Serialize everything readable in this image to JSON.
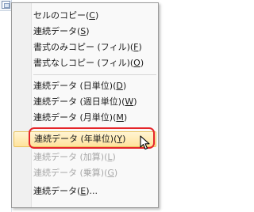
{
  "context_menu": {
    "items": [
      {
        "text": "セルのコピー(",
        "key": "C",
        "suffix": ")",
        "disabled": false
      },
      {
        "text": "連続データ(",
        "key": "S",
        "suffix": ")",
        "disabled": false
      },
      {
        "text": "書式のみコピー (フィル)(",
        "key": "F",
        "suffix": ")",
        "disabled": false
      },
      {
        "text": "書式なしコピー (フィル)(",
        "key": "O",
        "suffix": ")",
        "disabled": false
      },
      {
        "text": "連続データ (日単位)(",
        "key": "D",
        "suffix": ")",
        "disabled": false
      },
      {
        "text": "連続データ (週日単位)(",
        "key": "W",
        "suffix": ")",
        "disabled": false
      },
      {
        "text": "連続データ (月単位)(",
        "key": "M",
        "suffix": ")",
        "disabled": false
      },
      {
        "text": "連続データ (年単位)(",
        "key": "Y",
        "suffix": ")",
        "disabled": false,
        "highlighted": true
      },
      {
        "text": "連続データ (加算)(",
        "key": "L",
        "suffix": ")",
        "disabled": true
      },
      {
        "text": "連続データ (乗算)(",
        "key": "G",
        "suffix": ")",
        "disabled": true
      },
      {
        "text": "連続データ(",
        "key": "E",
        "suffix": ")...",
        "disabled": false
      }
    ]
  },
  "colors": {
    "annotation": "#e5252a",
    "highlight_top": "#fff4d2",
    "highlight_bottom": "#ffe39c"
  },
  "icons": {
    "pointer": "mouse-pointer-icon",
    "autofill": "auto-fill-options-icon"
  }
}
